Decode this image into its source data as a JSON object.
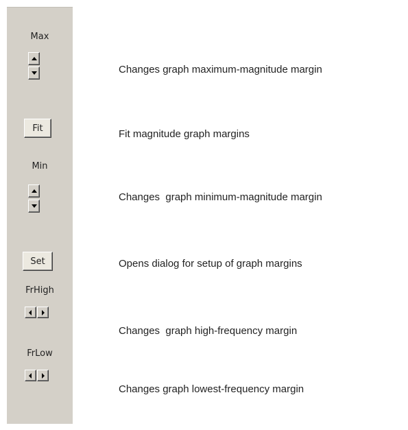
{
  "panel": {
    "max_label": "Max",
    "min_label": "Min",
    "fit_label": "Fit",
    "set_label": "Set",
    "frhigh_label": "FrHigh",
    "frlow_label": "FrLow"
  },
  "descriptions": {
    "max": "Changes graph maximum-magnitude margin",
    "fit": "Fit magnitude graph margins",
    "min": "Changes  graph minimum-magnitude margin",
    "set": "Opens dialog for setup of graph margins",
    "frhigh": "Changes  graph high-frequency margin",
    "frlow": "Changes graph lowest-frequency margin"
  },
  "icons": {
    "up": "arrow-up-icon",
    "down": "arrow-down-icon",
    "left": "arrow-left-icon",
    "right": "arrow-right-icon"
  },
  "colors": {
    "panel_bg": "#d4d0c8",
    "text": "#222222",
    "background": "#ffffff"
  }
}
